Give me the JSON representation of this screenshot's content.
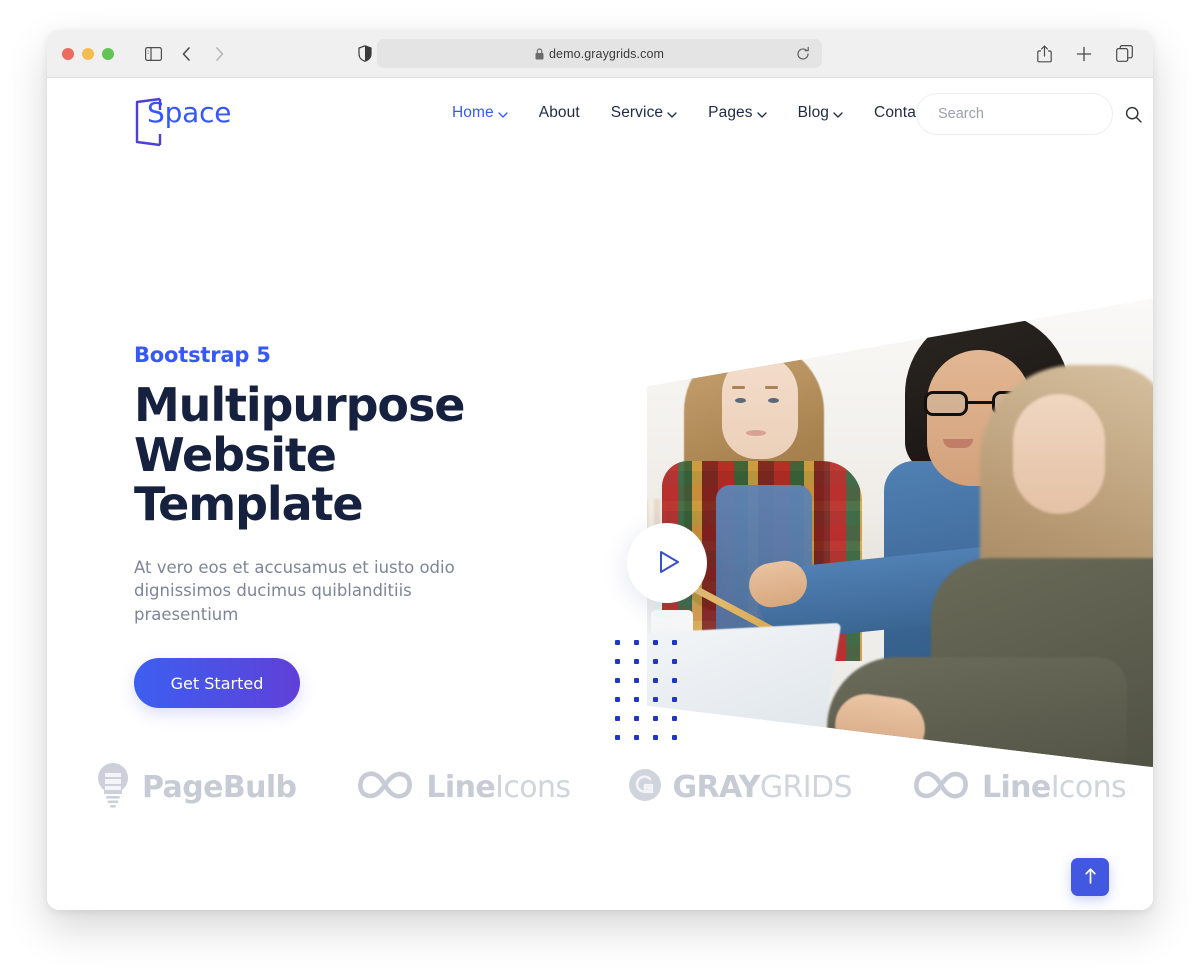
{
  "browser": {
    "url": "demo.graygrids.com",
    "lock_icon": "lock-icon",
    "reload_icon": "reload-icon",
    "sidebar_icon": "sidebar-toggle-icon",
    "back_icon": "chevron-left-icon",
    "forward_icon": "chevron-right-icon",
    "shield_icon": "privacy-shield-icon",
    "share_icon": "share-icon",
    "new_tab_icon": "plus-icon",
    "tabs_icon": "tab-overview-icon"
  },
  "site": {
    "logo_text": "Space",
    "nav": [
      {
        "label": "Home",
        "active": true,
        "has_dropdown": true
      },
      {
        "label": "About",
        "active": false,
        "has_dropdown": false
      },
      {
        "label": "Service",
        "active": false,
        "has_dropdown": true
      },
      {
        "label": "Pages",
        "active": false,
        "has_dropdown": true
      },
      {
        "label": "Blog",
        "active": false,
        "has_dropdown": true
      },
      {
        "label": "Contact",
        "active": false,
        "has_dropdown": false
      }
    ],
    "search": {
      "placeholder": "Search",
      "value": "",
      "icon": "search-icon"
    }
  },
  "hero": {
    "eyebrow": "Bootstrap 5",
    "title": "Multipurpose Website Template",
    "subtitle": "At vero eos et accusamus et iusto odio dignissimos ducimus quiblanditiis praesentium",
    "cta_label": "Get Started",
    "play_icon": "play-icon",
    "image_alt": "three colleagues at a table looking at a laptop"
  },
  "brands": [
    {
      "name": "PageBulb",
      "icon": "lightbulb-icon",
      "bold_part": "PageBulb",
      "light_part": ""
    },
    {
      "name": "LineIcons",
      "icon": "infinity-icon",
      "bold_part": "Line",
      "light_part": "Icons"
    },
    {
      "name": "GRAYGRIDS",
      "icon": "graygrids-icon",
      "bold_part": "GRAY",
      "light_part": "GRIDS"
    },
    {
      "name": "LineIcons",
      "icon": "infinity-icon",
      "bold_part": "Line",
      "light_part": "Icons"
    }
  ],
  "scroll_top": {
    "icon": "arrow-up-icon",
    "label": "Back to top"
  },
  "colors": {
    "accent_blue": "#3758f9",
    "title_navy": "#16213f",
    "body_gray": "#7d8597",
    "brand_gray": "#c3c7d2",
    "cta_gradient_from": "#3c5ff0",
    "cta_gradient_to": "#6040d8",
    "scroll_top_bg": "#4258e0"
  }
}
